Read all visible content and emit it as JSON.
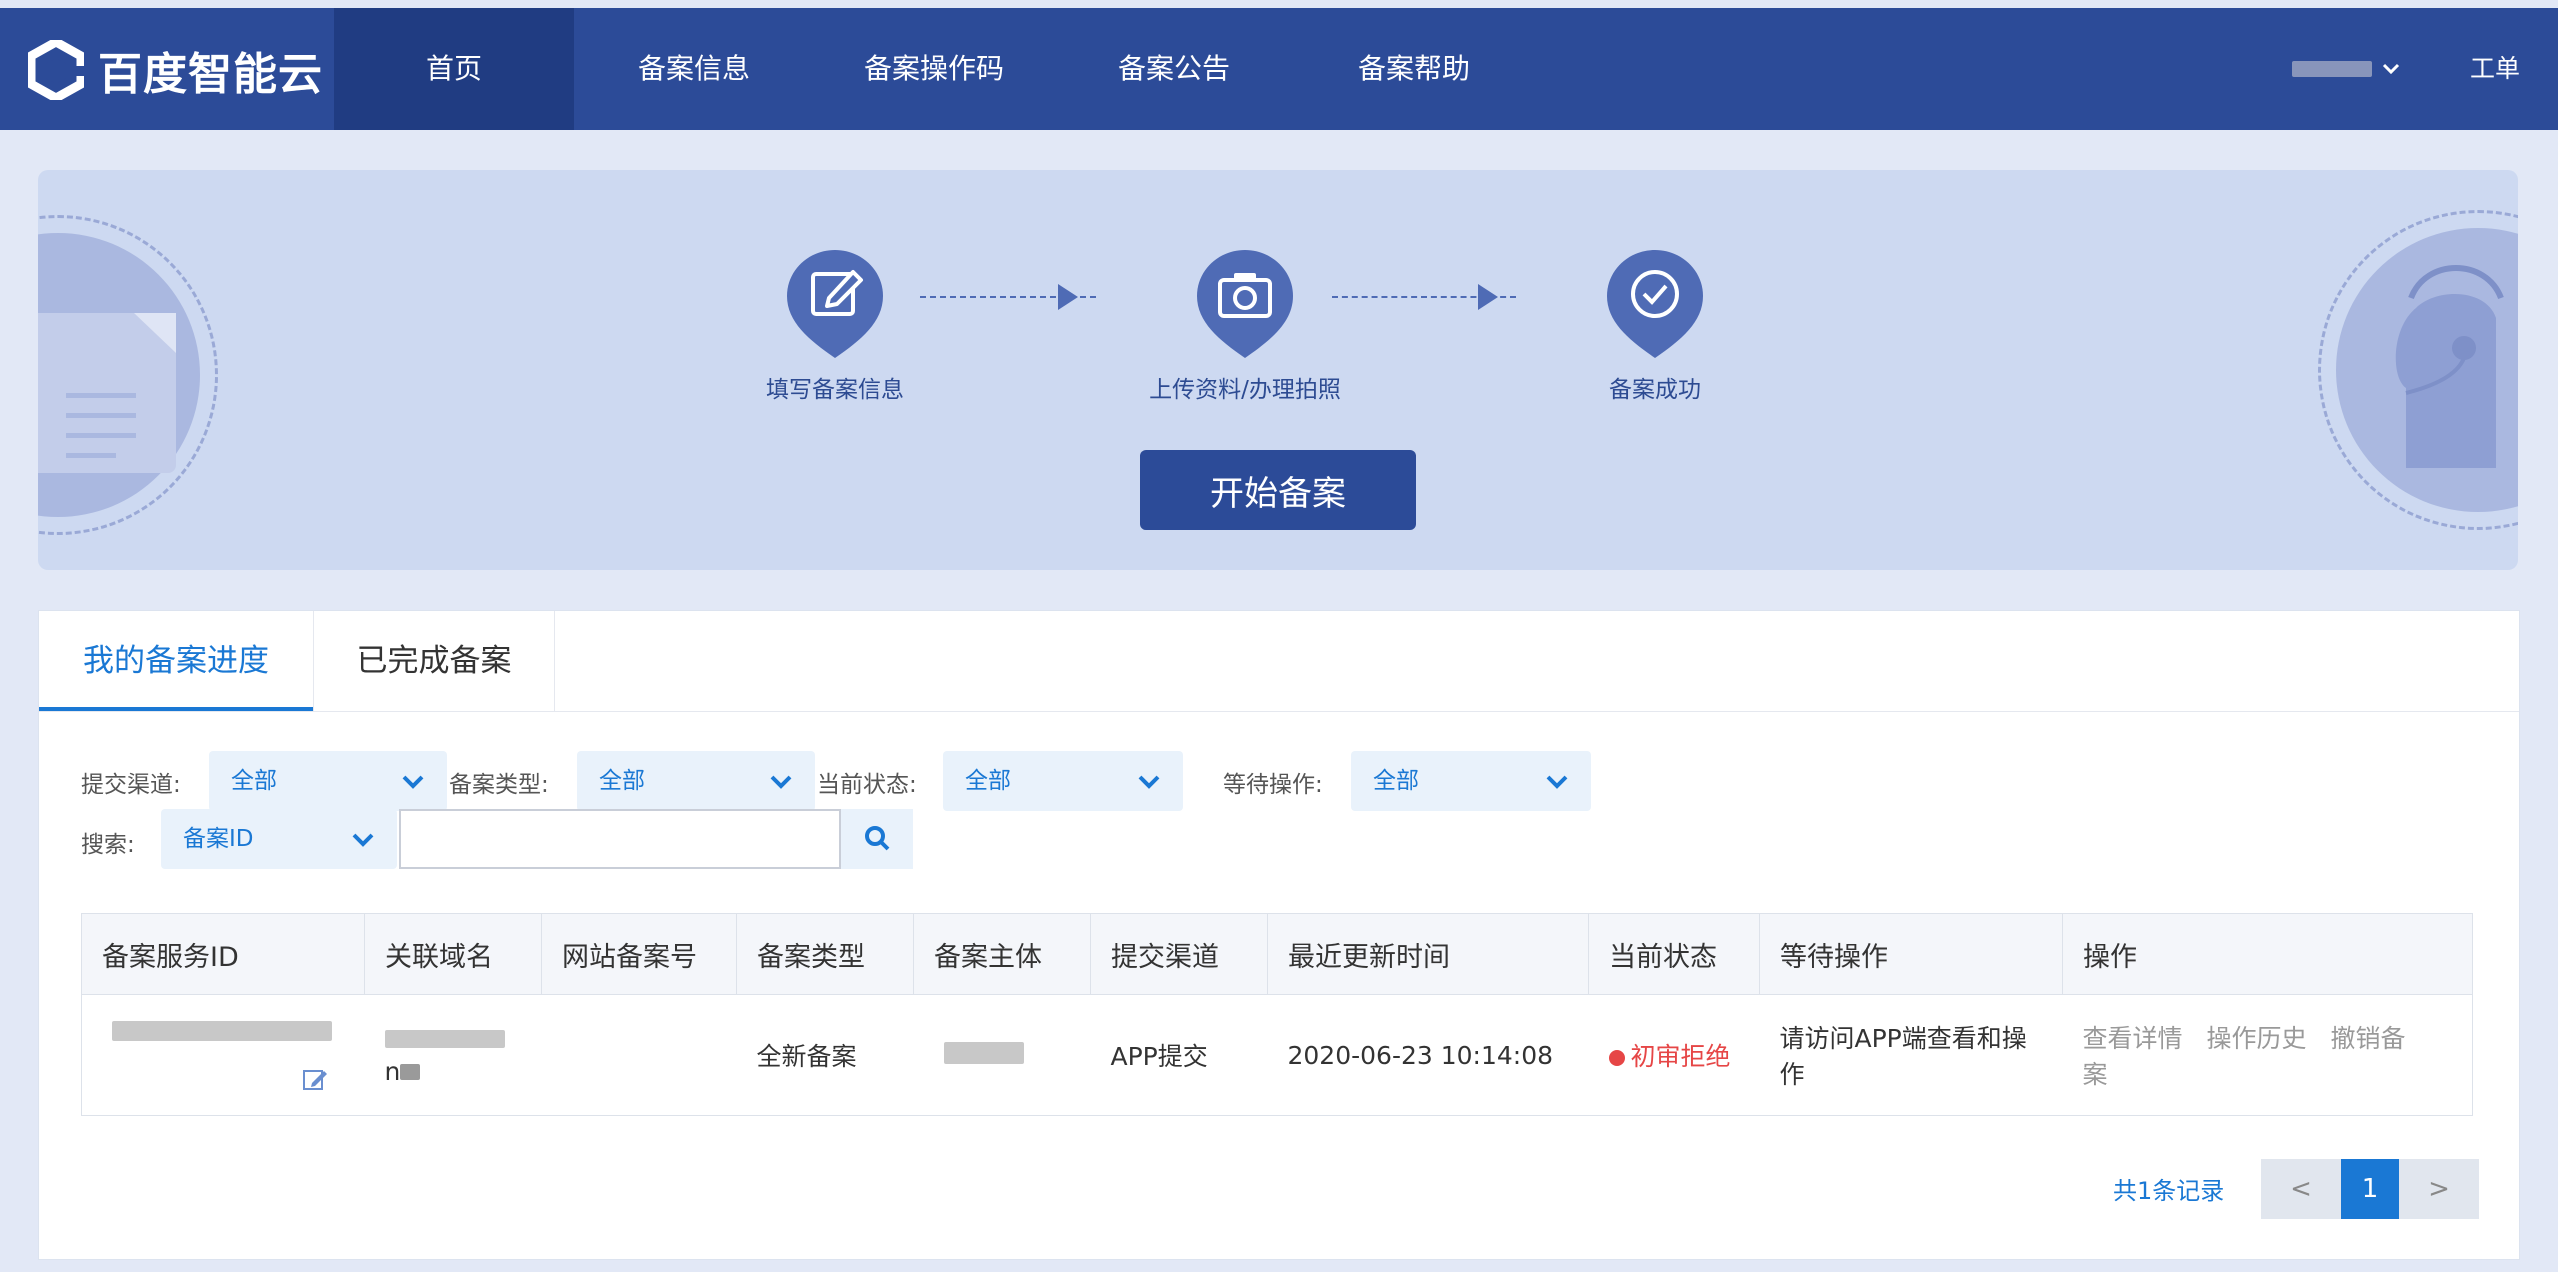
{
  "brand": {
    "name": "百度智能云"
  },
  "nav": {
    "items": [
      {
        "label": "首页",
        "active": true
      },
      {
        "label": "备案信息"
      },
      {
        "label": "备案操作码"
      },
      {
        "label": "备案公告"
      },
      {
        "label": "备案帮助"
      }
    ],
    "workorder": "工单"
  },
  "banner": {
    "steps": [
      {
        "label": "填写备案信息",
        "icon": "edit-icon"
      },
      {
        "label": "上传资料/办理拍照",
        "icon": "camera-icon"
      },
      {
        "label": "备案成功",
        "icon": "check-circle-icon"
      }
    ],
    "start_button": "开始备案"
  },
  "tabs": [
    {
      "label": "我的备案进度",
      "active": true
    },
    {
      "label": "已完成备案"
    }
  ],
  "filters": {
    "channel": {
      "label": "提交渠道:",
      "value": "全部"
    },
    "type": {
      "label": "备案类型:",
      "value": "全部"
    },
    "status": {
      "label": "当前状态:",
      "value": "全部"
    },
    "pending": {
      "label": "等待操作:",
      "value": "全部"
    },
    "search": {
      "label": "搜索:",
      "field": "备案ID",
      "value": ""
    }
  },
  "table": {
    "columns": [
      "备案服务ID",
      "关联域名",
      "网站备案号",
      "备案类型",
      "备案主体",
      "提交渠道",
      "最近更新时间",
      "当前状态",
      "等待操作",
      "操作"
    ],
    "rows": [
      {
        "domain_tail": "n",
        "record_no": "",
        "type": "全新备案",
        "channel": "APP提交",
        "updated": "2020-06-23 10:14:08",
        "status": "初审拒绝",
        "pending": "请访问APP端查看和操作",
        "actions": [
          "查看详情",
          "操作历史",
          "撤销备案"
        ]
      }
    ]
  },
  "pagination": {
    "total": "共1条记录",
    "prev": "<",
    "page": "1",
    "next": ">"
  },
  "colors": {
    "nav_bg": "#2c4b98",
    "accent": "#1a78d4",
    "error": "#e64646",
    "banner_bg": "#cdd9f1"
  }
}
